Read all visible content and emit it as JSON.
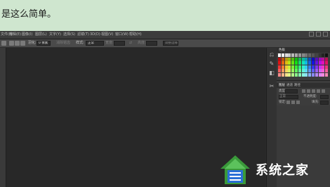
{
  "caption": {
    "text": "是这么简单。"
  },
  "menubar": {
    "items": [
      "文件(F)",
      "编辑(E)",
      "图像(I)",
      "图层(L)",
      "文字(Y)",
      "选择(S)",
      "滤镜(T)",
      "3D(D)",
      "视图(V)",
      "窗口(W)",
      "帮助(H)"
    ]
  },
  "options": {
    "feather_label": "羽化:",
    "feather_value": "0 像素",
    "antialias_label": "消除锯齿",
    "style_label": "样式:",
    "style_value": "正常",
    "width_label": "宽度:",
    "height_label": "高度:",
    "refine_label": "调整边缘..."
  },
  "panel": {
    "swatches_tab": "色板",
    "layer_tabs": [
      "图层",
      "通道",
      "路径"
    ],
    "kind_label": "类型",
    "blend_mode": "正常",
    "opacity_label": "不透明度:",
    "lock_label": "锁定:",
    "fill_label": "填充:"
  },
  "watermark": {
    "text": "系统之家"
  },
  "colors": {
    "accent_blue": "#2a6fd6",
    "swatch_red": "#e02020",
    "caption_bg": "#cfe6cf"
  }
}
